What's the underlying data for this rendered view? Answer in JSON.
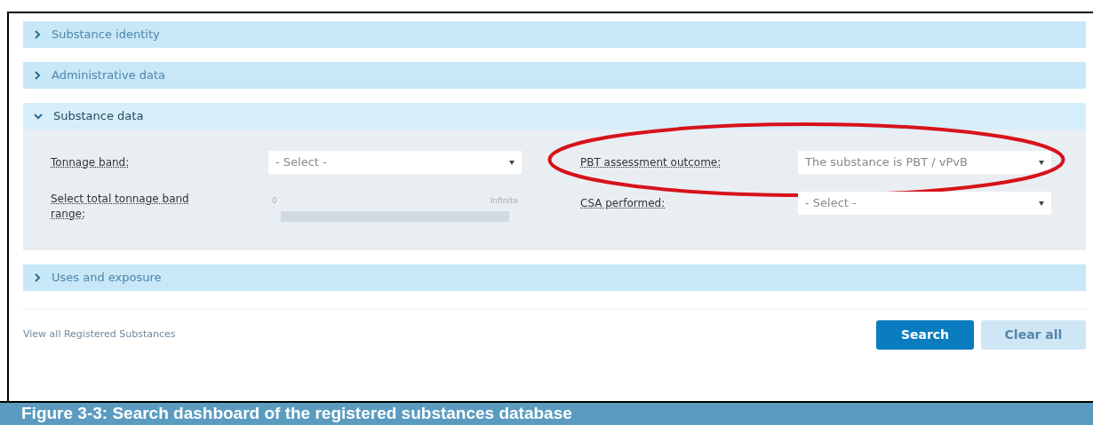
{
  "sections": [
    {
      "title": "Substance identity",
      "expanded": false
    },
    {
      "title": "Administrative data",
      "expanded": false
    },
    {
      "title": "Substance data",
      "expanded": true,
      "fields": [
        {
          "kind": "select",
          "label": "Tonnage band:",
          "value": "- Select -",
          "highlight": false
        },
        {
          "kind": "select",
          "label": "PBT assessment outcome:",
          "value": "The substance is PBT / vPvB",
          "highlight": true
        },
        {
          "kind": "range",
          "label": "Select total tonnage band range:",
          "min_label": "0",
          "max_label": "Infinite",
          "highlight": false
        },
        {
          "kind": "select",
          "label": "CSA performed:",
          "value": "- Select -",
          "highlight": false
        }
      ]
    },
    {
      "title": "Uses and exposure",
      "expanded": false
    }
  ],
  "footer": {
    "link": "View all Registered Substances",
    "buttons": [
      {
        "label": "Search",
        "kind": "primary"
      },
      {
        "label": "Clear all",
        "kind": "secondary"
      }
    ]
  },
  "caption": "Figure 3-3:  Search dashboard of the registered substances database"
}
